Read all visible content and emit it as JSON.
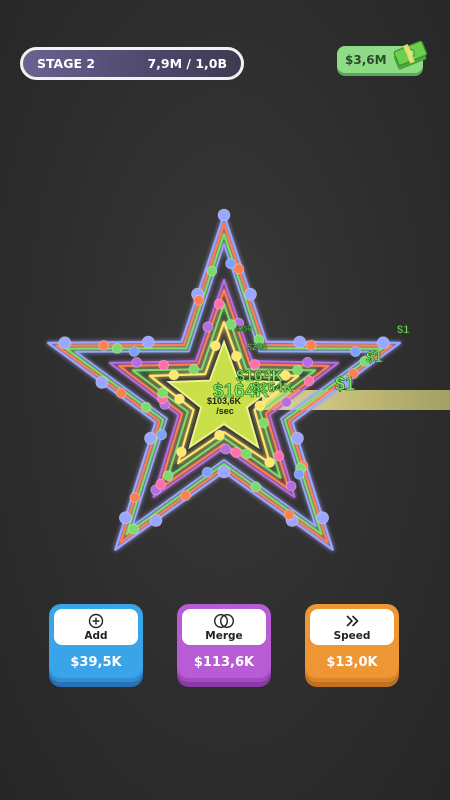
{
  "hud": {
    "stage_label": "STAGE 2",
    "progress_text": "7,9M / 1,0B",
    "money": "$3,6M"
  },
  "playfield": {
    "rate_text": "$103,6K",
    "rate_unit": "/sec",
    "floating_texts": [
      "$1",
      "$1",
      "$1",
      "$164K",
      "$164K",
      "$164K",
      "$256",
      "$256"
    ]
  },
  "buttons": {
    "add": {
      "label": "Add",
      "price": "$39,5K"
    },
    "merge": {
      "label": "Merge",
      "price": "$113,6K"
    },
    "speed": {
      "label": "Speed",
      "price": "$13,0K"
    }
  },
  "colors": {
    "star_outer": "#9aa6ff",
    "track_orange": "#ff7f55",
    "track_green": "#7bdc6c",
    "track_purple": "#b56ee0",
    "track_yellow": "#ffe86b",
    "money_green": "#7ef064"
  }
}
